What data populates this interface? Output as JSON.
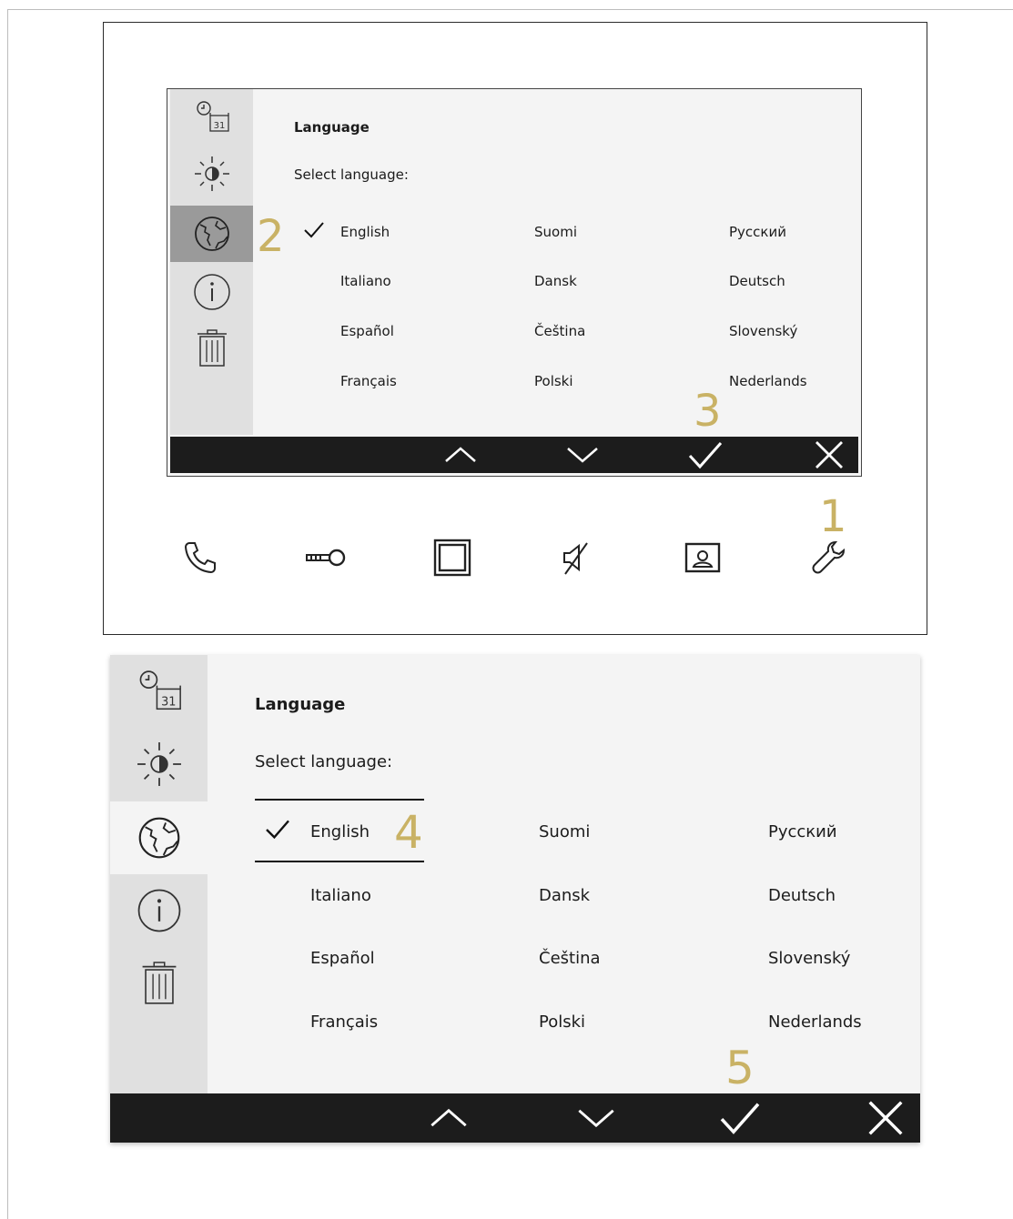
{
  "language_screen": {
    "title": "Language",
    "subtitle": "Select language:",
    "selected": "English",
    "languages": [
      "English",
      "Suomi",
      "Русский",
      "Italiano",
      "Dansk",
      "Deutsch",
      "Español",
      "Čeština",
      "Slovenský",
      "Français",
      "Polski",
      "Nederlands"
    ]
  },
  "markers": [
    "1",
    "2",
    "3",
    "4",
    "5"
  ],
  "sidebar_icons": [
    "clock-calendar-icon",
    "brightness-icon",
    "globe-icon",
    "info-icon",
    "trash-icon"
  ],
  "calendar_day": "31",
  "device_buttons": [
    "phone-icon",
    "key-icon",
    "monitor-icon",
    "mute-icon",
    "camera-contact-icon",
    "wrench-icon"
  ],
  "toolbar_icons": [
    "chevron-up-icon",
    "chevron-down-icon",
    "confirm-check-icon",
    "close-icon"
  ],
  "colors": {
    "marker": "#c9b265",
    "toolbar": "#1c1c1c",
    "sidebar": "#e0e0e0",
    "sidebar_selected": "#9a9a9a"
  }
}
